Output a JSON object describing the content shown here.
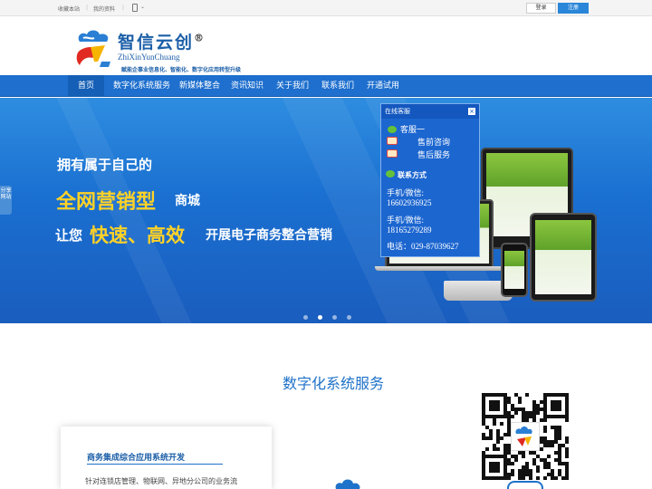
{
  "topbar": {
    "favorite": "收藏本站",
    "separator": "|",
    "profile": "我的资料",
    "login": "登录",
    "register": "注册"
  },
  "logo": {
    "title": "智信云创",
    "registered": "®",
    "subtitle": "ZhiXinYunChuang",
    "slogan": "赋能企事业信息化、智能化、数字化应用转型升级"
  },
  "nav": {
    "items": [
      {
        "label": "首页",
        "active": true
      },
      {
        "label": "数字化系统服务"
      },
      {
        "label": "新媒体整合"
      },
      {
        "label": "资讯知识"
      },
      {
        "label": "关于我们"
      },
      {
        "label": "联系我们"
      },
      {
        "label": "开通试用"
      }
    ]
  },
  "banner": {
    "line1": "拥有属于自己的",
    "line2_highlight": "全网营销型",
    "line2_rest": "商城",
    "line3_prefix": "让您",
    "line3_highlight": "快速、高效",
    "line3_rest": "开展电子商务整合营销",
    "slides_total": 4,
    "slide_active": 2
  },
  "sidetab": {
    "label": "分享网站"
  },
  "service_panel": {
    "title": "在线客服",
    "close": "×",
    "wx_service": "客服一",
    "presale": "售前咨询",
    "aftersale": "售后服务",
    "contact_title": "联系方式",
    "phone1_label": "手机/微信:",
    "phone1": "16602936925",
    "phone2_label": "手机/微信:",
    "phone2": "18165279289",
    "tel": "电话：029-87039627"
  },
  "section": {
    "title": "数字化系统服务"
  },
  "card": {
    "title": "商务集成综合应用系统开发",
    "text": "针对连锁店管理、物联网、异地分公司的业务流"
  },
  "colors": {
    "brand_blue": "#1e6fce",
    "accent_yellow": "#ffd227",
    "title_blue": "#1f72c9"
  }
}
